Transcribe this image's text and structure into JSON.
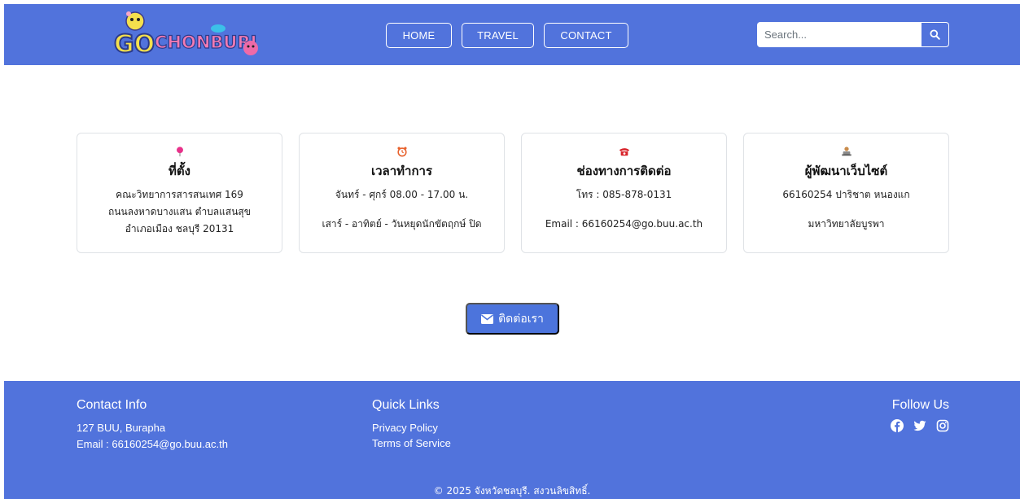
{
  "header": {
    "logo_text": "GO CHONBURI",
    "nav": [
      {
        "label": "HOME"
      },
      {
        "label": "TRAVEL"
      },
      {
        "label": "CONTACT"
      }
    ],
    "search": {
      "placeholder": "Search..."
    }
  },
  "cards": [
    {
      "icon": "map-pin-icon",
      "title": "ที่ตั้ง",
      "lines": [
        "คณะวิทยาการสารสนเทศ 169",
        "ถนนลงหาดบางแสน ตำบลแสนสุข",
        "อำเภอเมือง ชลบุรี 20131"
      ]
    },
    {
      "icon": "alarm-clock-icon",
      "title": "เวลาทำการ",
      "lines": [
        "จันทร์ - ศุกร์ 08.00 - 17.00 น.",
        "เสาร์ - อาทิตย์ - วันหยุดนักขัตฤกษ์ ปิด"
      ]
    },
    {
      "icon": "telephone-icon",
      "title": "ช่องทางการติดต่อ",
      "lines": [
        "โทร : 085-878-0131",
        "Email : 66160254@go.buu.ac.th"
      ]
    },
    {
      "icon": "developer-icon",
      "title": "ผู้พัฒนาเว็บไซต์",
      "lines": [
        "66160254 ปาริชาต หนองแก",
        "มหาวิทยาลัยบูรพา"
      ]
    }
  ],
  "contact_button": {
    "label": "ติดต่อเรา",
    "icon": "envelope-icon"
  },
  "footer": {
    "contact_info": {
      "title": "Contact Info",
      "address": "127 BUU, Burapha",
      "email": "Email : 66160254@go.buu.ac.th"
    },
    "quick_links": {
      "title": "Quick Links",
      "links": [
        "Privacy Policy",
        "Terms of Service"
      ]
    },
    "follow": {
      "title": "Follow Us",
      "icons": [
        "facebook-icon",
        "twitter-icon",
        "instagram-icon"
      ]
    },
    "copyright": "© 2025 จังหวัดชลบุรี. สงวนลิขสิทธิ์."
  },
  "colors": {
    "primary": "#5173dc",
    "button": "#4c74dc",
    "card_border": "#dfe2e6"
  }
}
